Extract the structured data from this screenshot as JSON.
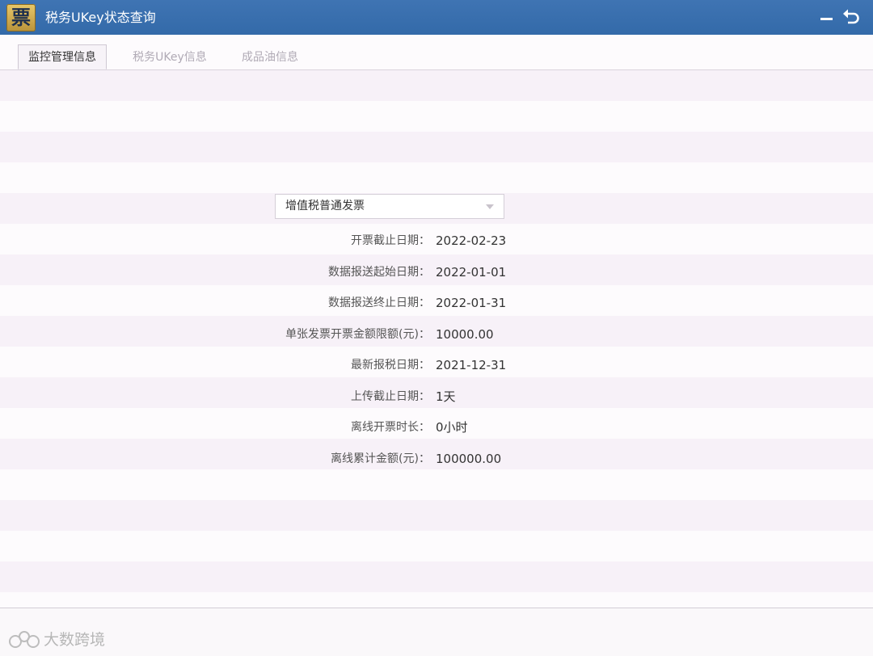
{
  "window": {
    "title": "税务UKey状态查询",
    "logo_char": "票",
    "icons": {
      "logo": "ticket-logo",
      "minimize": "minimize-icon",
      "back": "back-arrow-icon"
    }
  },
  "tabs": [
    {
      "label": "监控管理信息",
      "active": true
    },
    {
      "label": "税务UKey信息",
      "active": false
    },
    {
      "label": "成品油信息",
      "active": false
    }
  ],
  "invoice_type_select": {
    "value": "增值税普通发票"
  },
  "fields": [
    {
      "label": "开票截止日期：",
      "value": "2022-02-23"
    },
    {
      "label": "数据报送起始日期：",
      "value": "2022-01-01"
    },
    {
      "label": "数据报送终止日期：",
      "value": "2022-01-31"
    },
    {
      "label": "单张发票开票金额限额(元)：",
      "value": "10000.00"
    },
    {
      "label": "最新报税日期：",
      "value": "2021-12-31"
    },
    {
      "label": "上传截止日期：",
      "value": "1天"
    },
    {
      "label": "离线开票时长：",
      "value": "0小时"
    },
    {
      "label": "离线累计金额(元)：",
      "value": "100000.00"
    }
  ],
  "watermark": {
    "text": "大数跨境"
  },
  "colors": {
    "titlebar": "#3a6fae",
    "band": "#f7f1f8"
  }
}
